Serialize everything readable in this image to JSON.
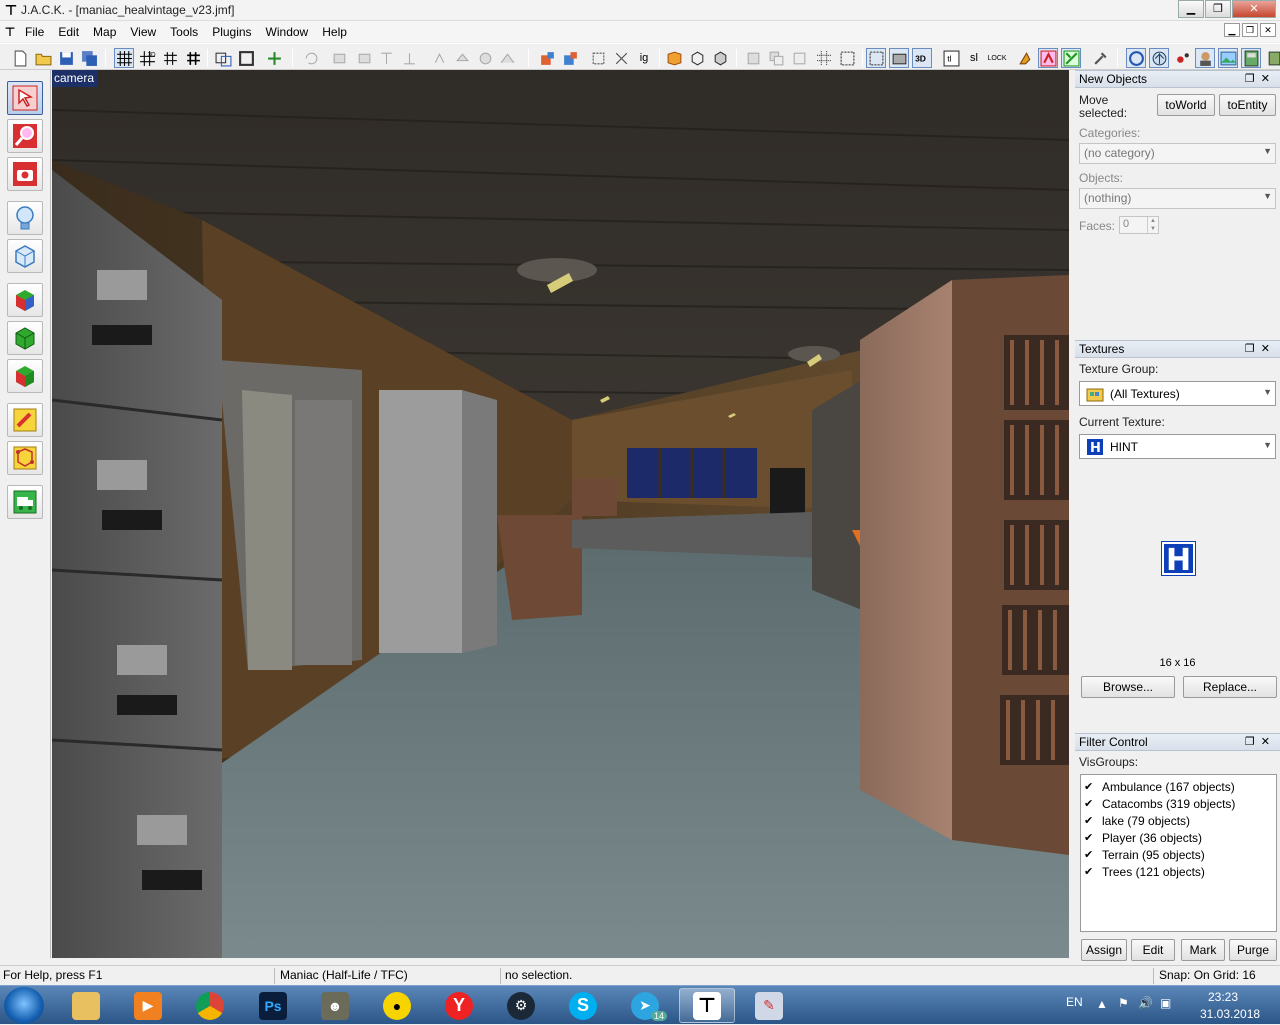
{
  "window": {
    "title": "J.A.C.K. - [maniac_healvintage_v23.jmf]",
    "controls": [
      "minimize",
      "maximize",
      "close"
    ]
  },
  "menu": [
    "File",
    "Edit",
    "Map",
    "View",
    "Tools",
    "Plugins",
    "Window",
    "Help"
  ],
  "toolbar": {
    "icons": [
      "new-file-icon",
      "open-file-icon",
      "save-icon",
      "save-all-icon",
      "grid-icon",
      "grid-3d-icon",
      "grid-smaller-icon",
      "grid-larger-icon",
      "carve-icon",
      "hollow-icon",
      "texture-lock-icon",
      "undo-icon",
      "redo-icon",
      "align-left-icon",
      "align-right-icon",
      "align-top-icon",
      "align-bottom-icon",
      "flip-icon",
      "group-icon",
      "ungroup-icon",
      "toggle-ignore-icon",
      "hide-icon",
      "unhide-icon",
      "entity-icon",
      "tie-icon",
      "vertex-icon",
      "clip-icon",
      "view-2d-icon",
      "view-3d-icon",
      "texture-app-icon",
      "tl-icon",
      "sl-icon",
      "lock-icon",
      "run-icon",
      "compile-icon",
      "check-icon",
      "camera-icon",
      "sphere-icon",
      "decal-icon",
      "profile-icon",
      "image-icon",
      "window-icon"
    ],
    "text_labels": {
      "ig": "ig",
      "tl": "tl",
      "sl": "sl",
      "lock": "LOCK"
    }
  },
  "left_tools": [
    {
      "name": "selection-tool-icon",
      "active": true
    },
    {
      "name": "magnify-tool-icon",
      "active": false
    },
    {
      "name": "camera-tool-icon",
      "active": false
    },
    {
      "name": "entity-light-tool-icon",
      "active": false
    },
    {
      "name": "block-tool-icon",
      "active": false
    },
    {
      "name": "texture-tool-icon",
      "active": false
    },
    {
      "name": "apply-texture-tool-icon",
      "active": false
    },
    {
      "name": "decal-tool-icon",
      "active": false
    },
    {
      "name": "clip-tool-icon",
      "active": false
    },
    {
      "name": "vertex-tool-icon",
      "active": false
    },
    {
      "name": "path-tool-icon",
      "active": false
    }
  ],
  "viewport": {
    "label": "camera"
  },
  "new_objects": {
    "header": "New Objects",
    "move_selected_label": "Move selected:",
    "to_world": "toWorld",
    "to_entity": "toEntity",
    "categories_label": "Categories:",
    "categories_value": "(no category)",
    "objects_label": "Objects:",
    "objects_value": "(nothing)",
    "faces_label": "Faces:",
    "faces_value": "0"
  },
  "textures": {
    "header": "Textures",
    "group_label": "Texture Group:",
    "group_value": "(All Textures)",
    "current_label": "Current Texture:",
    "current_value": "HINT",
    "preview_letter": "H",
    "size": "16 x 16",
    "browse": "Browse...",
    "replace": "Replace..."
  },
  "filter": {
    "header": "Filter Control",
    "visgroups_label": "VisGroups:",
    "visgroups": [
      "Ambulance (167 objects)",
      "Catacombs (319 objects)",
      "lake (79 objects)",
      "Player (36 objects)",
      "Terrain (95 objects)",
      "Trees (121 objects)"
    ],
    "buttons": {
      "assign": "Assign",
      "edit": "Edit",
      "mark": "Mark",
      "purge": "Purge"
    }
  },
  "status": {
    "help": "For Help, press F1",
    "game": "Maniac (Half-Life / TFC)",
    "selection": "no selection.",
    "snap": "Snap: On Grid: 16"
  },
  "taskbar": {
    "apps": [
      "explorer-icon",
      "media-player-icon",
      "chrome-icon",
      "photoshop-icon",
      "gimp-icon",
      "yellow-app-icon",
      "yandex-icon",
      "steam-icon",
      "skype-icon",
      "telegram-icon",
      "jack-icon",
      "paint-icon"
    ],
    "ps_label": "Ps",
    "y_label": "Y",
    "s_label": "S",
    "telegram_badge": "14",
    "language": "EN",
    "time": "23:23",
    "date": "31.03.2018"
  },
  "colors": {
    "viewport_label_bg": "#1c2f66",
    "hint_texture": "#0d3fb8",
    "taskbar": "#2b5687"
  }
}
